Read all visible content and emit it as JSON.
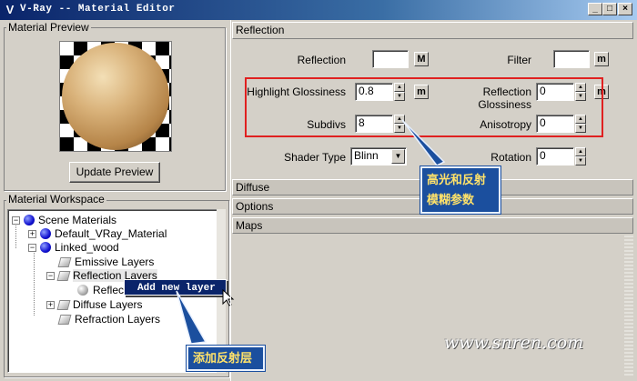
{
  "window": {
    "title": "V-Ray -- Material Editor",
    "controls": {
      "minimize": "_",
      "maximize": "□",
      "close": "×"
    }
  },
  "preview": {
    "group_label": "Material Preview",
    "update_button": "Update Preview"
  },
  "workspace": {
    "group_label": "Material Workspace",
    "tree": {
      "root": "Scene Materials",
      "default_material": "Default_VRay_Material",
      "linked": "Linked_wood",
      "emissive": "Emissive Layers",
      "reflection": "Reflection Layers",
      "reflection_child": "Reflection",
      "diffuse": "Diffuse Layers",
      "refraction": "Refraction Layers"
    },
    "context_menu": {
      "item": "Add new layer"
    }
  },
  "reflection_panel": {
    "header": "Reflection",
    "reflection_label": "Reflection",
    "reflection_map_btn": "M",
    "filter_label": "Filter",
    "filter_map_btn": "m",
    "highlight_label": "Highlight Glossiness",
    "highlight_value": "0.8",
    "highlight_map_btn": "m",
    "refl_gloss_label": "Reflection Glossiness",
    "refl_gloss_value": "0",
    "refl_gloss_map_btn": "m",
    "subdivs_label": "Subdivs",
    "subdivs_value": "8",
    "anisotropy_label": "Anisotropy",
    "anisotropy_value": "0",
    "shader_label": "Shader Type",
    "shader_value": "Blinn",
    "rotation_label": "Rotation",
    "rotation_value": "0"
  },
  "rollouts": {
    "diffuse": "Diffuse",
    "options": "Options",
    "maps": "Maps"
  },
  "annotations": {
    "gloss_note_line1": "高光和反射",
    "gloss_note_line2": "模糊参数",
    "add_layer_note": "添加反射层",
    "watermark": "www.snren.com"
  },
  "colors": {
    "highlight_box": "#e02020",
    "callout_bg": "#1b4f9e",
    "callout_text": "#ffe26a"
  }
}
